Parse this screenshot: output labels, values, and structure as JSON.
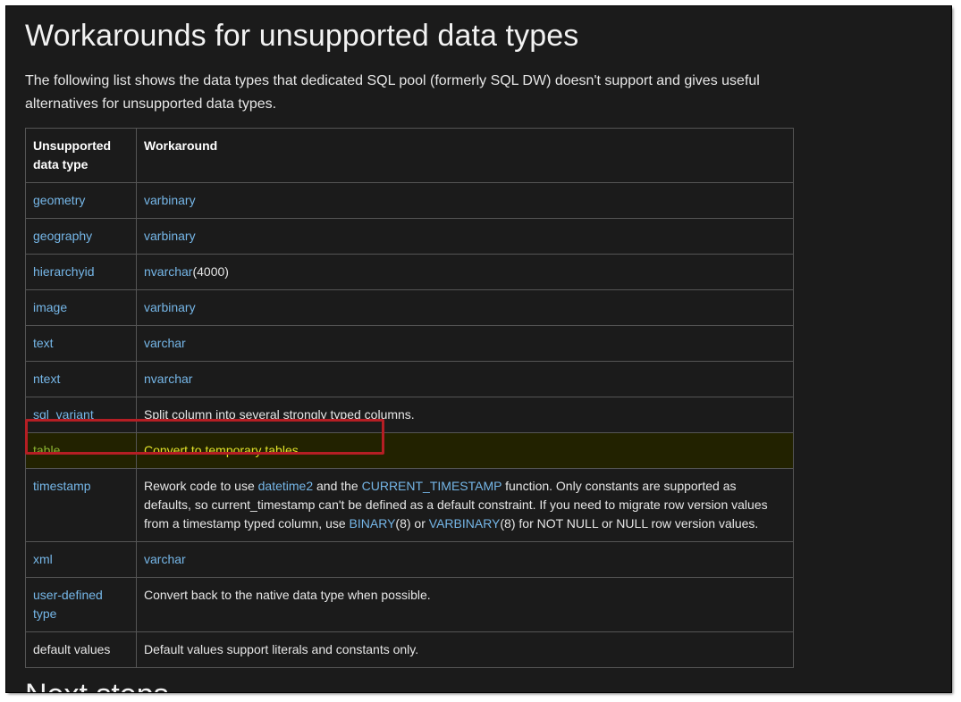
{
  "page": {
    "title": "Workarounds for unsupported data types",
    "intro": "The following list shows the data types that dedicated SQL pool (formerly SQL DW) doesn't support and gives useful alternatives for unsupported data types.",
    "next_heading": "Next steps"
  },
  "table": {
    "headers": {
      "col1_line1": "Unsupported",
      "col1_line2": "data type",
      "col2": "Workaround"
    },
    "rows": [
      {
        "type": "geometry",
        "workaround_link": "varbinary"
      },
      {
        "type": "geography",
        "workaround_link": "varbinary"
      },
      {
        "type": "hierarchyid",
        "workaround_link": "nvarchar",
        "workaround_suffix": "(4000)"
      },
      {
        "type": "image",
        "workaround_link": "varbinary"
      },
      {
        "type": "text",
        "workaround_link": "varchar"
      },
      {
        "type": "ntext",
        "workaround_link": "nvarchar"
      },
      {
        "type": "sql_variant",
        "workaround_text": "Split column into several strongly typed columns."
      },
      {
        "type": "table",
        "workaround_text": "Convert to temporary tables.",
        "highlighted": true
      },
      {
        "type": "timestamp",
        "parts": {
          "p1": "Rework code to use ",
          "link1": "datetime2",
          "p2": " and the ",
          "link2": "CURRENT_TIMESTAMP",
          "p3": " function. Only constants are supported as defaults, so current_timestamp can't be defined as a default constraint. If you need to migrate row version values from a timestamp typed column, use ",
          "link3": "BINARY",
          "p4": "(8) or ",
          "link4": "VARBINARY",
          "p5": "(8) for NOT NULL or NULL row version values."
        }
      },
      {
        "type": "xml",
        "workaround_link": "varchar"
      },
      {
        "type": "user-defined type",
        "workaround_text": "Convert back to the native data type when possible."
      },
      {
        "type": "default values",
        "workaround_text": "Default values support literals and constants only."
      }
    ]
  },
  "colors": {
    "background": "#1b1b1b",
    "link": "#75b6e7",
    "highlight_box": "#b51e24",
    "highlight_type": "#8db531",
    "highlight_text": "#e3e32a"
  }
}
